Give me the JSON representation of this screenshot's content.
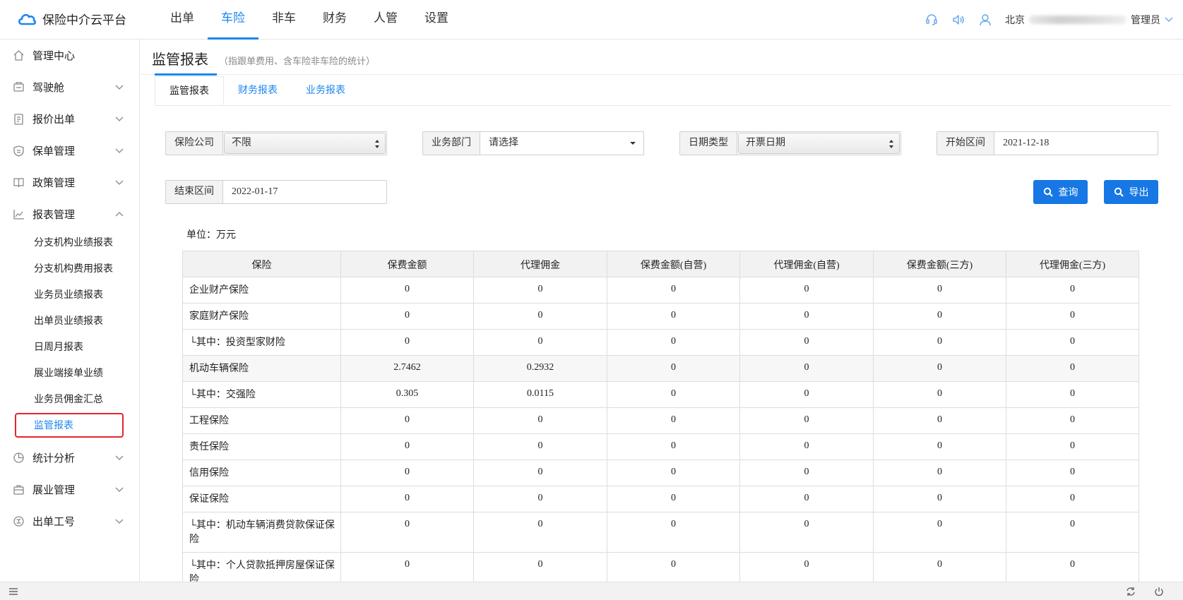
{
  "app": {
    "title": "保险中介云平台"
  },
  "topnav": [
    {
      "label": "出单"
    },
    {
      "label": "车险"
    },
    {
      "label": "非车"
    },
    {
      "label": "财务"
    },
    {
      "label": "人管"
    },
    {
      "label": "设置"
    }
  ],
  "user": {
    "org_prefix": "北京",
    "role": "管理员"
  },
  "sidebar": {
    "items": [
      {
        "label": "管理中心",
        "icon": "home-icon"
      },
      {
        "label": "驾驶舱",
        "icon": "dashboard-icon"
      },
      {
        "label": "报价出单",
        "icon": "clipboard-icon"
      },
      {
        "label": "保单管理",
        "icon": "shield-icon"
      },
      {
        "label": "政策管理",
        "icon": "book-icon"
      },
      {
        "label": "报表管理",
        "icon": "chart-icon"
      }
    ],
    "report_children": [
      {
        "label": "分支机构业绩报表"
      },
      {
        "label": "分支机构费用报表"
      },
      {
        "label": "业务员业绩报表"
      },
      {
        "label": "出单员业绩报表"
      },
      {
        "label": "日周月报表"
      },
      {
        "label": "展业端接单业绩"
      },
      {
        "label": "业务员佣金汇总"
      },
      {
        "label": "监管报表"
      }
    ],
    "items_after": [
      {
        "label": "统计分析",
        "icon": "pie-icon"
      },
      {
        "label": "展业管理",
        "icon": "briefcase-icon"
      },
      {
        "label": "出单工号",
        "icon": "badge-icon"
      }
    ]
  },
  "page": {
    "title": "监管报表",
    "subtitle": "（指跟单费用、含车险非车险的统计）",
    "tabs": [
      {
        "label": "监管报表"
      },
      {
        "label": "财务报表"
      },
      {
        "label": "业务报表"
      }
    ]
  },
  "filters": {
    "company": {
      "label": "保险公司",
      "value": "不限"
    },
    "department": {
      "label": "业务部门",
      "value": "请选择"
    },
    "date_type": {
      "label": "日期类型",
      "value": "开票日期"
    },
    "start": {
      "label": "开始区间",
      "value": "2021-12-18"
    },
    "end": {
      "label": "结束区间",
      "value": "2022-01-17"
    }
  },
  "buttons": {
    "query": "查询",
    "export": "导出"
  },
  "unit": "单位：万元",
  "table": {
    "headers": [
      "保险",
      "保费金额",
      "代理佣金",
      "保费金额(自营)",
      "代理佣金(自营)",
      "保费金额(三方)",
      "代理佣金(三方)"
    ],
    "rows": [
      [
        "企业财产保险",
        "0",
        "0",
        "0",
        "0",
        "0",
        "0"
      ],
      [
        "家庭财产保险",
        "0",
        "0",
        "0",
        "0",
        "0",
        "0"
      ],
      [
        "└其中：投资型家财险",
        "0",
        "0",
        "0",
        "0",
        "0",
        "0"
      ],
      [
        "机动车辆保险",
        "2.7462",
        "0.2932",
        "0",
        "0",
        "0",
        "0"
      ],
      [
        "└其中：交强险",
        "0.305",
        "0.0115",
        "0",
        "0",
        "0",
        "0"
      ],
      [
        "工程保险",
        "0",
        "0",
        "0",
        "0",
        "0",
        "0"
      ],
      [
        "责任保险",
        "0",
        "0",
        "0",
        "0",
        "0",
        "0"
      ],
      [
        "信用保险",
        "0",
        "0",
        "0",
        "0",
        "0",
        "0"
      ],
      [
        "保证保险",
        "0",
        "0",
        "0",
        "0",
        "0",
        "0"
      ],
      [
        "└其中：机动车辆消费贷款保证保险",
        "0",
        "0",
        "0",
        "0",
        "0",
        "0"
      ],
      [
        "└其中：个人贷款抵押房屋保证保险",
        "0",
        "0",
        "0",
        "0",
        "0",
        "0"
      ]
    ]
  },
  "colors": {
    "accent": "#1b86f0",
    "button": "#1677e5",
    "highlight_box": "#e3262c"
  }
}
